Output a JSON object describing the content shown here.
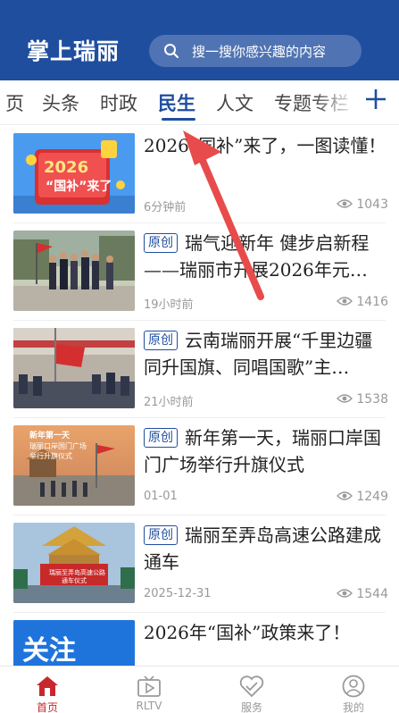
{
  "header": {
    "logo": "掌上瑞丽",
    "search_placeholder": "搜一搜你感兴趣的内容"
  },
  "tabs": [
    {
      "label": "页"
    },
    {
      "label": "头条"
    },
    {
      "label": "时政"
    },
    {
      "label": "民生",
      "active": true
    },
    {
      "label": "人文"
    },
    {
      "label": "专题专栏"
    }
  ],
  "news": [
    {
      "title": "2026“国补”来了，一图读懂！",
      "badge": "",
      "time": "6分钟前",
      "views": "1043",
      "thumb_text": "2026\n“国补”来了"
    },
    {
      "title": "瑞气迎新年 健步启新程——瑞丽市开展2026年元…",
      "badge": "原创",
      "time": "19小时前",
      "views": "1416",
      "thumb_text": ""
    },
    {
      "title": "云南瑞丽开展“千里边疆同升国旗、同唱国歌”主…",
      "badge": "原创",
      "time": "21小时前",
      "views": "1538",
      "thumb_text": ""
    },
    {
      "title": "新年第一天，瑞丽口岸国门广场举行升旗仪式",
      "badge": "原创",
      "time": "01-01",
      "views": "1249",
      "thumb_text": "新年第一天\n瑞丽口岸国门广场\n举行升旗仪式"
    },
    {
      "title": "瑞丽至弄岛高速公路建成通车",
      "badge": "原创",
      "time": "2025-12-31",
      "views": "1544",
      "thumb_text": "瑞丽至弄岛高速公路\n通车仪式"
    },
    {
      "title": "2026年“国补”政策来了！",
      "badge": "",
      "time": "",
      "views": "",
      "thumb_text": "关注"
    }
  ],
  "bottom_nav": [
    {
      "label": "首页",
      "icon": "home-icon",
      "active": true
    },
    {
      "label": "RLTV",
      "icon": "tv-icon"
    },
    {
      "label": "服务",
      "icon": "service-icon"
    },
    {
      "label": "我的",
      "icon": "profile-icon"
    }
  ],
  "colors": {
    "brand": "#1f4e9e",
    "accent": "#c8282d",
    "arrow": "#e84b4b"
  }
}
